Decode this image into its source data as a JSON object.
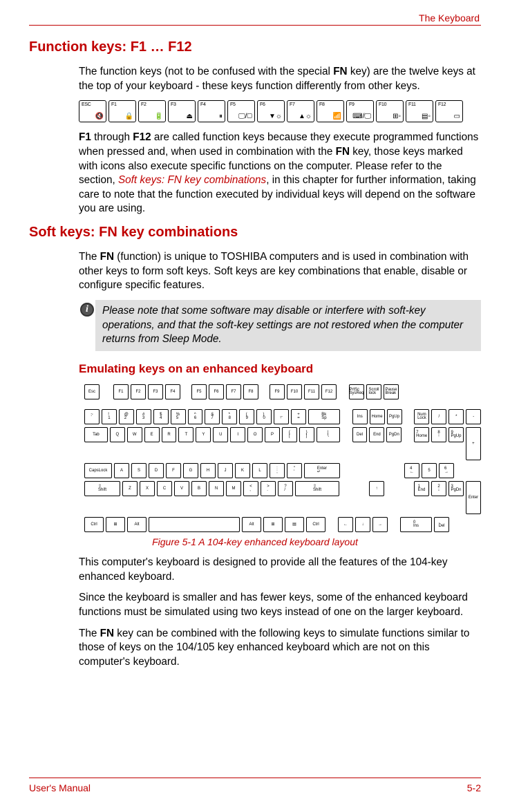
{
  "header": {
    "right": "The Keyboard"
  },
  "section1": {
    "title": "Function keys: F1 … F12",
    "para1_a": "The function keys (not to be confused with the special ",
    "para1_b_bold": "FN",
    "para1_c": " key) are the twelve keys at the top of your keyboard - these keys function differently from other keys.",
    "fn_keys": [
      "ESC",
      "F1",
      "F2",
      "F3",
      "F4",
      "F5",
      "F6",
      "F7",
      "F8",
      "F9",
      "F10",
      "F11",
      "F12"
    ],
    "fn_icons": [
      "🔇",
      "🔒",
      "🔋",
      "⏏",
      "⏸",
      "🖵/▢",
      "▼☼",
      "▲☼",
      "📶",
      "⌨/🖵",
      "⊞◦",
      "▤◦",
      "▭"
    ],
    "para2_a_bold": "F1",
    "para2_b": " through ",
    "para2_c_bold": "F12",
    "para2_d": " are called function keys because they execute programmed functions when pressed and, when used in combination with the ",
    "para2_e_bold": "FN",
    "para2_f": " key, those keys marked with icons also execute specific functions on the computer. Please refer to the section, ",
    "para2_link": "Soft keys: FN key combinations",
    "para2_g": ", in this chapter for further information, taking care to note that the function executed by individual keys will depend on the software you are using."
  },
  "section2": {
    "title": "Soft keys: FN key combinations",
    "para1_a": "The ",
    "para1_b_bold": "FN",
    "para1_c": " (function) is unique to TOSHIBA computers and is used in combination with other keys to form soft keys. Soft keys are key combinations that enable, disable or configure specific features.",
    "note": "Please note that some software may disable or interfere with soft-key operations, and that the soft-key settings are not restored when the computer returns from Sleep Mode."
  },
  "section3": {
    "title": "Emulating keys on an enhanced keyboard",
    "caption": "Figure 5-1 A 104-key enhanced keyboard layout",
    "para1": "This computer's keyboard is designed to provide all the features of the 104-key enhanced keyboard.",
    "para2": "Since the keyboard is smaller and has fewer keys, some of the enhanced keyboard functions must be simulated using two keys instead of one on the larger keyboard.",
    "para3_a": "The ",
    "para3_b_bold": "FN",
    "para3_c": " key can be combined with the following keys to simulate functions similar to those of keys on the 104/105 key enhanced keyboard which are not on this computer's keyboard."
  },
  "kb104": {
    "r0_main": [
      "Esc"
    ],
    "r0_fg1": [
      "F1",
      "F2",
      "F3",
      "F4"
    ],
    "r0_fg2": [
      "F5",
      "F6",
      "F7",
      "F8"
    ],
    "r0_fg3": [
      "F9",
      "F10",
      "F11",
      "F12"
    ],
    "r0_sys": [
      "PrtSc SysReq",
      "Scroll lock",
      "Pause Break"
    ],
    "r1_main": [
      "~ `",
      "! 1",
      "@ 2",
      "# 3",
      "$ 4",
      "% 5",
      "^ 6",
      "& 7",
      "* 8",
      "( 9",
      ") 0",
      "_ -",
      "+ =",
      "Bk Sp"
    ],
    "r1_nav": [
      "Ins",
      "Home",
      "PgUp"
    ],
    "r1_num_top": [
      "Num Lock",
      "/",
      "*",
      "-"
    ],
    "r2_main": [
      "Tab",
      "Q",
      "W",
      "E",
      "R",
      "T",
      "Y",
      "U",
      "I",
      "O",
      "P",
      "{ [",
      "} ]",
      "| \\"
    ],
    "r2_nav": [
      "Del",
      "End",
      "PgDn"
    ],
    "r2_num": [
      "7 Home",
      "8 ↑",
      "9 PgUp"
    ],
    "r3_main": [
      "CapsLock",
      "A",
      "S",
      "D",
      "F",
      "G",
      "H",
      "J",
      "K",
      "L",
      ": ;",
      "\" '",
      "Enter ↵"
    ],
    "r3_num": [
      "4 ←",
      "5",
      "6 →"
    ],
    "r4_main": [
      "⇧ Shift",
      "Z",
      "X",
      "C",
      "V",
      "B",
      "N",
      "M",
      "< ,",
      "> .",
      "? /",
      "⇧ Shift"
    ],
    "r4_arrow": [
      "↑"
    ],
    "r4_num": [
      "1 End",
      "2 ↓",
      "3 PgDn"
    ],
    "r5_main": [
      "Ctrl",
      "⊞",
      "Alt",
      "",
      "Alt",
      "⊞",
      "▤",
      "Ctrl"
    ],
    "r5_arrow": [
      "←",
      "↓",
      "→"
    ],
    "r5_num": [
      "0 Ins",
      ". Del"
    ],
    "num_plus": "+",
    "num_enter": "Enter"
  },
  "footer": {
    "left": "User's Manual",
    "right": "5-2"
  }
}
